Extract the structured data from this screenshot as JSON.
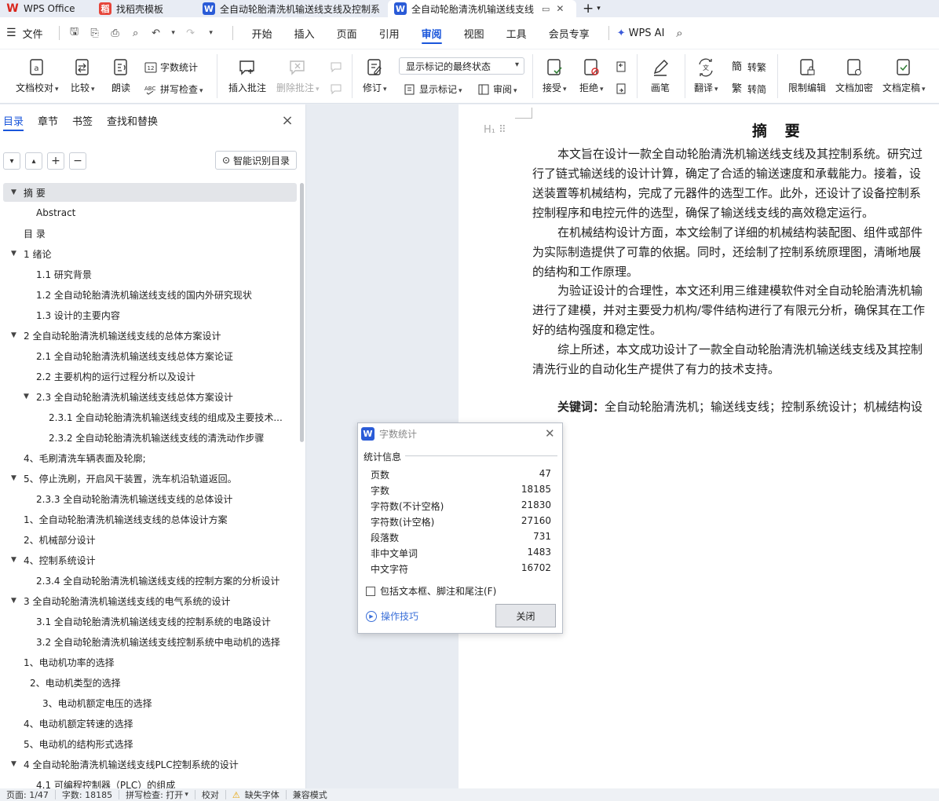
{
  "tabs": [
    {
      "label": "WPS Office",
      "icon": "wps-logo-icon"
    },
    {
      "label": "找稻壳模板",
      "icon": "template-icon"
    },
    {
      "label": "全自动轮胎清洗机输送线支线及控制系",
      "icon": "word-doc-icon"
    },
    {
      "label": "全自动轮胎清洗机输送线支线",
      "icon": "word-doc-icon"
    }
  ],
  "new_tab": "+",
  "menu": {
    "file": "文件",
    "tabs": [
      "开始",
      "插入",
      "页面",
      "引用",
      "审阅",
      "视图",
      "工具",
      "会员专享"
    ],
    "active_tab": "审阅",
    "ai": "WPS AI"
  },
  "ribbon": {
    "proofread": "文档校对",
    "compare": "比较",
    "read_aloud": "朗读",
    "word_count": "字数统计",
    "spell_check": "拼写检查",
    "insert_comment": "插入批注",
    "delete_comment": "删除批注",
    "track": "修订",
    "markup_state": "显示标记的最终状态",
    "show_markup": "显示标记",
    "review": "审阅",
    "accept": "接受",
    "reject": "拒绝",
    "pen": "画笔",
    "translate": "翻译",
    "to_trad": "转繁",
    "to_simp": "转简",
    "restrict": "限制编辑",
    "encrypt": "文档加密",
    "finalize": "文档定稿"
  },
  "nav": {
    "tabs": [
      "目录",
      "章节",
      "书签",
      "查找和替换"
    ],
    "smart_toc": "智能识别目录",
    "items": [
      {
        "label": "摘 要",
        "level": 0,
        "expand": true,
        "selected": true
      },
      {
        "label": "Abstract",
        "level": 1
      },
      {
        "label": "目 录",
        "level": 0
      },
      {
        "label": "1 绪论",
        "level": 0,
        "expand": true
      },
      {
        "label": "1.1 研究背景",
        "level": 1
      },
      {
        "label": "1.2 全自动轮胎清洗机输送线支线的国内外研究现状",
        "level": 1
      },
      {
        "label": "1.3 设计的主要内容",
        "level": 1
      },
      {
        "label": "2 全自动轮胎清洗机输送线支线的总体方案设计",
        "level": 0,
        "expand": true
      },
      {
        "label": "2.1 全自动轮胎清洗机输送线支线总体方案论证",
        "level": 1
      },
      {
        "label": "2.2 主要机构的运行过程分析以及设计",
        "level": 1
      },
      {
        "label": "2.3 全自动轮胎清洗机输送线支线总体方案设计",
        "level": 1,
        "expand": true
      },
      {
        "label": "2.3.1 全自动轮胎清洗机输送线支线的组成及主要技术...",
        "level": 2
      },
      {
        "label": "2.3.2 全自动轮胎清洗机输送线支线的清洗动作步骤",
        "level": 2
      },
      {
        "label": "4、毛刷清洗车辆表面及轮廓;",
        "level": 0
      },
      {
        "label": "5、停止洗刷，开启风干装置，洗车机沿轨道返回。",
        "level": 0,
        "expand": true
      },
      {
        "label": "2.3.3 全自动轮胎清洗机输送线支线的总体设计",
        "level": 1
      },
      {
        "label": "1、全自动轮胎清洗机输送线支线的总体设计方案",
        "level": 0
      },
      {
        "label": "2、机械部分设计",
        "level": 0
      },
      {
        "label": "4、控制系统设计",
        "level": 0,
        "expand": true
      },
      {
        "label": "2.3.4 全自动轮胎清洗机输送线支线的控制方案的分析设计",
        "level": 1
      },
      {
        "label": "3 全自动轮胎清洗机输送线支线的电气系统的设计",
        "level": 0,
        "expand": true
      },
      {
        "label": "3.1 全自动轮胎清洗机输送线支线的控制系统的电路设计",
        "level": 1
      },
      {
        "label": "3.2 全自动轮胎清洗机输送线支线控制系统中电动机的选择",
        "level": 1
      },
      {
        "label": "1、电动机功率的选择",
        "level": 0
      },
      {
        "label": "2、电动机类型的选择",
        "level": 0.5
      },
      {
        "label": "3、电动机额定电压的选择",
        "level": 1.5
      },
      {
        "label": "4、电动机额定转速的选择",
        "level": 0
      },
      {
        "label": "5、电动机的结构形式选择",
        "level": 0
      },
      {
        "label": "4 全自动轮胎清洗机输送线支线PLC控制系统的设计",
        "level": 0,
        "expand": true
      },
      {
        "label": "4.1 可编程控制器（PLC）的组成",
        "level": 1
      }
    ]
  },
  "doc": {
    "title": "摘  要",
    "lines": [
      "本文旨在设计一款全自动轮胎清洗机输送线支线及其控制系统。研究过",
      "行了链式输送线的设计计算，确定了合适的输送速度和承载能力。接着，设",
      "送装置等机械结构，完成了元器件的选型工作。此外，还设计了设备控制系",
      "控制程序和电控元件的选型，确保了输送线支线的高效稳定运行。",
      "在机械结构设计方面，本文绘制了详细的机械结构装配图、组件或部件",
      "为实际制造提供了可靠的依据。同时，还绘制了控制系统原理图，清晰地展",
      "的结构和工作原理。",
      "为验证设计的合理性，本文还利用三维建模软件对全自动轮胎清洗机输",
      "进行了建模，并对主要受力机构/零件结构进行了有限元分析，确保其在工作",
      "好的结构强度和稳定性。",
      "综上所述，本文成功设计了一款全自动轮胎清洗机输送线支线及其控制",
      "清洗行业的自动化生产提供了有力的技术支持。"
    ],
    "keywords_label": "关键词：",
    "keywords": "全自动轮胎清洗机；输送线支线；控制系统设计；机械结构设"
  },
  "dialog": {
    "title": "字数统计",
    "section": "统计信息",
    "stats": [
      {
        "label": "页数",
        "value": "47"
      },
      {
        "label": "字数",
        "value": "18185"
      },
      {
        "label": "字符数(不计空格)",
        "value": "21830"
      },
      {
        "label": "字符数(计空格)",
        "value": "27160"
      },
      {
        "label": "段落数",
        "value": "731"
      },
      {
        "label": "非中文单词",
        "value": "1483"
      },
      {
        "label": "中文字符",
        "value": "16702"
      }
    ],
    "include_label": "包括文本框、脚注和尾注(F)",
    "tips": "操作技巧",
    "close": "关闭"
  },
  "status": {
    "page": "页面: 1/47",
    "words": "字数: 18185",
    "spell": "拼写检查: 打开",
    "proof": "校对",
    "missing_font": "缺失字体",
    "compat": "兼容模式"
  },
  "colors": {
    "accent": "#1a56db",
    "wps_red": "#d9261c",
    "doc_blue": "#2a5bd7"
  }
}
